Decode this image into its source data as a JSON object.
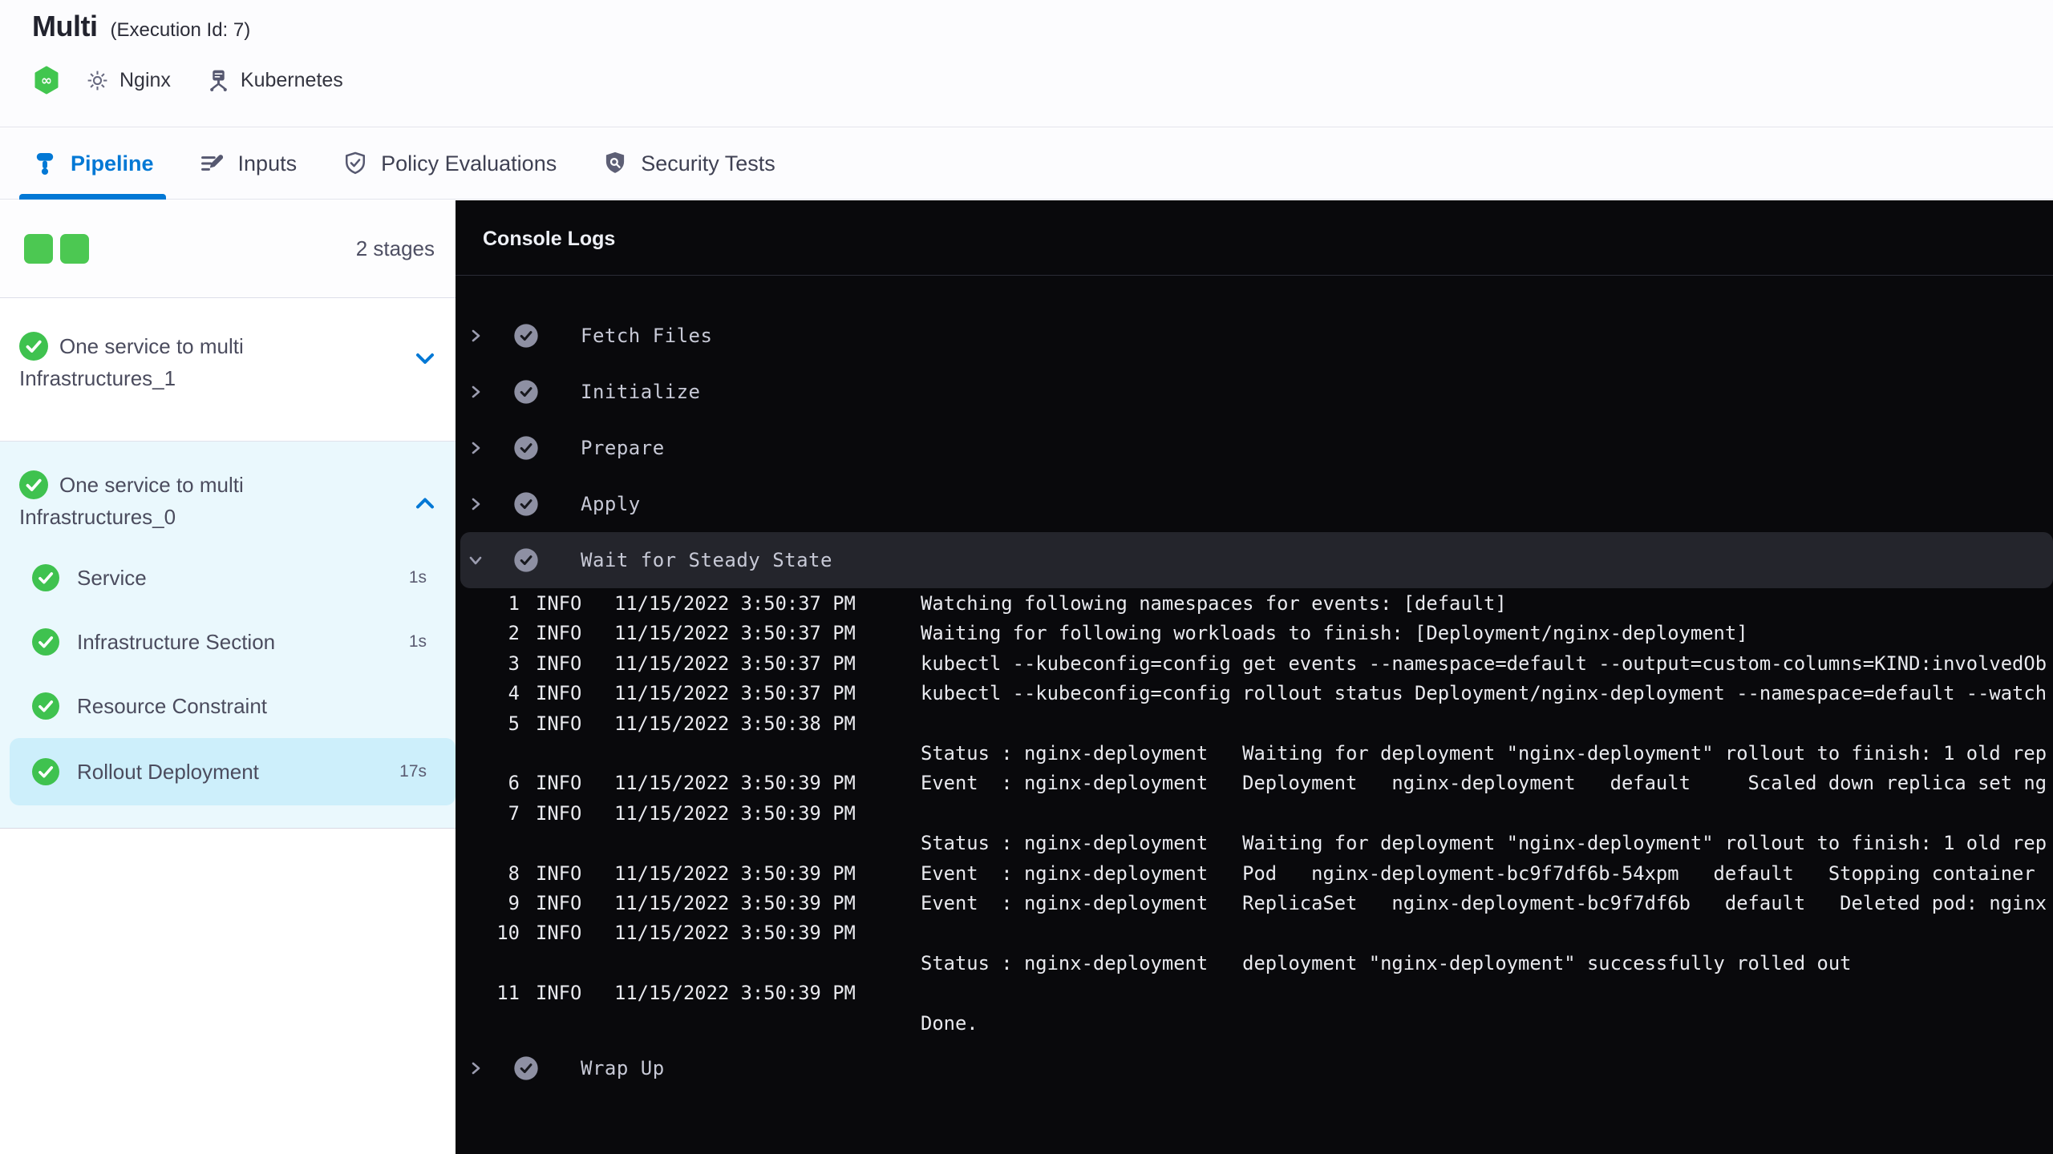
{
  "header": {
    "title": "Multi",
    "execution_id": "(Execution Id: 7)",
    "module_icon": "cd-module-icon",
    "service": {
      "icon": "gear-icon",
      "name": "Nginx"
    },
    "environment": {
      "icon": "infrastructure-icon",
      "name": "Kubernetes"
    }
  },
  "tabs": [
    {
      "label": "Pipeline",
      "icon": "pipeline-icon",
      "active": true
    },
    {
      "label": "Inputs",
      "icon": "inputs-icon",
      "active": false
    },
    {
      "label": "Policy Evaluations",
      "icon": "policy-shield-check-icon",
      "active": false
    },
    {
      "label": "Security Tests",
      "icon": "security-shield-search-icon",
      "active": false
    }
  ],
  "colors": {
    "accent_blue": "#0278d5",
    "success_green": "#3fc24f",
    "square_green": "#4cc852",
    "console_bg": "#09090c",
    "selected_step_bg": "#cdeffb",
    "stage_section_bg": "#eaf8fd"
  },
  "sidebar": {
    "stages_count": "2 stages",
    "stages": [
      {
        "name": "One service to multi Infrastructures_1",
        "status": "success",
        "expanded": false,
        "steps": []
      },
      {
        "name": "One service to multi Infrastructures_0",
        "status": "success",
        "expanded": true,
        "steps": [
          {
            "label": "Service",
            "duration": "1s",
            "status": "success",
            "selected": false
          },
          {
            "label": "Infrastructure Section",
            "duration": "1s",
            "status": "success",
            "selected": false
          },
          {
            "label": "Resource Constraint",
            "duration": "",
            "status": "success",
            "selected": false
          },
          {
            "label": "Rollout Deployment",
            "duration": "17s",
            "status": "success",
            "selected": true
          }
        ]
      }
    ]
  },
  "console": {
    "title": "Console Logs",
    "steps": [
      {
        "label": "Fetch Files",
        "status": "success",
        "expanded": false
      },
      {
        "label": "Initialize",
        "status": "success",
        "expanded": false
      },
      {
        "label": "Prepare",
        "status": "success",
        "expanded": false
      },
      {
        "label": "Apply",
        "status": "success",
        "expanded": false
      },
      {
        "label": "Wait for Steady State",
        "status": "success",
        "expanded": true
      },
      {
        "label": "Wrap Up",
        "status": "success",
        "expanded": false
      }
    ],
    "log_rows": [
      {
        "num": "1",
        "level": "INFO",
        "time": "11/15/2022 3:50:37 PM",
        "msg": "Watching following namespaces for events: [default]"
      },
      {
        "num": "2",
        "level": "INFO",
        "time": "11/15/2022 3:50:37 PM",
        "msg": "Waiting for following workloads to finish: [Deployment/nginx-deployment]"
      },
      {
        "num": "3",
        "level": "INFO",
        "time": "11/15/2022 3:50:37 PM",
        "msg": "kubectl --kubeconfig=config get events --namespace=default --output=custom-columns=KIND:involvedOb"
      },
      {
        "num": "4",
        "level": "INFO",
        "time": "11/15/2022 3:50:37 PM",
        "msg": "kubectl --kubeconfig=config rollout status Deployment/nginx-deployment --namespace=default --watch"
      },
      {
        "num": "5",
        "level": "INFO",
        "time": "11/15/2022 3:50:38 PM",
        "msg": ""
      },
      {
        "num": "",
        "level": "",
        "time": "",
        "msg": "Status : nginx-deployment   Waiting for deployment \"nginx-deployment\" rollout to finish: 1 old rep"
      },
      {
        "num": "6",
        "level": "INFO",
        "time": "11/15/2022 3:50:39 PM",
        "msg": "Event  : nginx-deployment   Deployment   nginx-deployment   default     Scaled down replica set ng"
      },
      {
        "num": "7",
        "level": "INFO",
        "time": "11/15/2022 3:50:39 PM",
        "msg": ""
      },
      {
        "num": "",
        "level": "",
        "time": "",
        "msg": "Status : nginx-deployment   Waiting for deployment \"nginx-deployment\" rollout to finish: 1 old rep"
      },
      {
        "num": "8",
        "level": "INFO",
        "time": "11/15/2022 3:50:39 PM",
        "msg": "Event  : nginx-deployment   Pod   nginx-deployment-bc9f7df6b-54xpm   default   Stopping container "
      },
      {
        "num": "9",
        "level": "INFO",
        "time": "11/15/2022 3:50:39 PM",
        "msg": "Event  : nginx-deployment   ReplicaSet   nginx-deployment-bc9f7df6b   default   Deleted pod: nginx"
      },
      {
        "num": "10",
        "level": "INFO",
        "time": "11/15/2022 3:50:39 PM",
        "msg": ""
      },
      {
        "num": "",
        "level": "",
        "time": "",
        "msg": "Status : nginx-deployment   deployment \"nginx-deployment\" successfully rolled out"
      },
      {
        "num": "11",
        "level": "INFO",
        "time": "11/15/2022 3:50:39 PM",
        "msg": ""
      },
      {
        "num": "",
        "level": "",
        "time": "",
        "msg": "Done."
      }
    ]
  }
}
